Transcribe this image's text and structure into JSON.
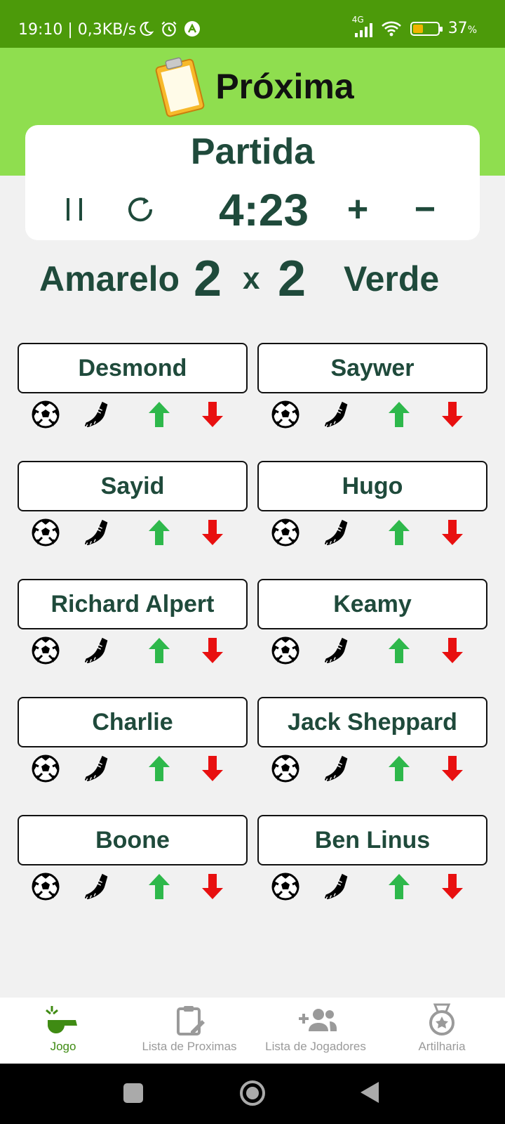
{
  "status_bar": {
    "time": "19:10 | 0,3KB/s",
    "network_label": "4G",
    "battery_pct": "37",
    "battery_unit": "%"
  },
  "header": {
    "title": "Próxima",
    "card_title": "Partida",
    "timer": "4:23",
    "plus_label": "+",
    "minus_label": "−"
  },
  "score": {
    "team_a": "Amarelo",
    "score_a": "2",
    "separator": "x",
    "score_b": "2",
    "team_b": "Verde"
  },
  "players": [
    {
      "name": "Desmond"
    },
    {
      "name": "Saywer"
    },
    {
      "name": "Sayid"
    },
    {
      "name": "Hugo"
    },
    {
      "name": "Richard Alpert"
    },
    {
      "name": "Keamy"
    },
    {
      "name": "Charlie"
    },
    {
      "name": "Jack Sheppard"
    },
    {
      "name": "Boone"
    },
    {
      "name": "Ben Linus"
    }
  ],
  "bottom_nav": {
    "items": [
      {
        "label": "Jogo",
        "icon": "whistle-icon",
        "active": true
      },
      {
        "label": "Lista de Proximas",
        "icon": "clipboard-edit-icon",
        "active": false
      },
      {
        "label": "Lista de Jogadores",
        "icon": "add-group-icon",
        "active": false
      },
      {
        "label": "Artilharia",
        "icon": "medal-icon",
        "active": false
      }
    ]
  },
  "colors": {
    "status_bar": "#4c9a0a",
    "header_bg": "#8fde4f",
    "primary_text": "#1f4a3b",
    "up_arrow": "#2eb84b",
    "down_arrow": "#e81010",
    "nav_active": "#3f8b13",
    "nav_inactive": "#9a9a9a"
  }
}
